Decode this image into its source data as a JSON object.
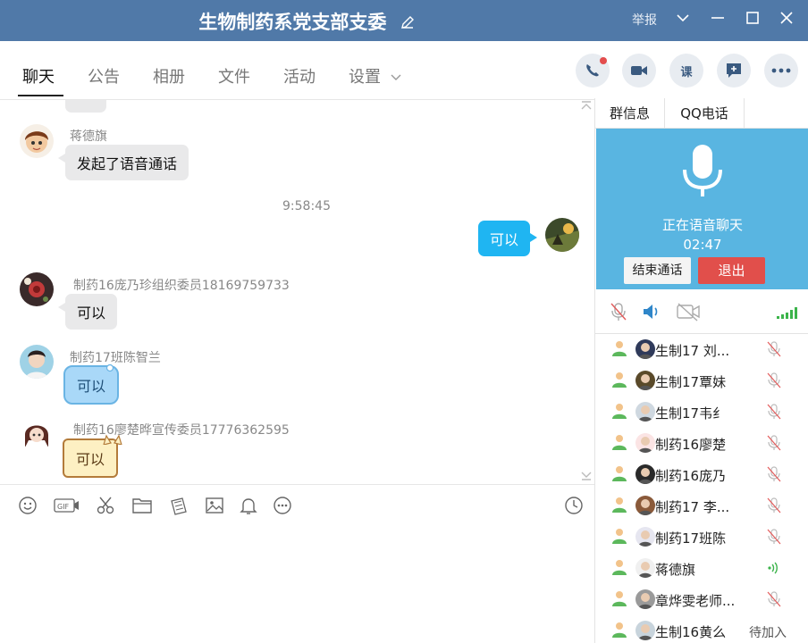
{
  "window": {
    "title": "生物制药系党支部支委",
    "report_label": "举报"
  },
  "tabs": [
    {
      "label": "聊天"
    },
    {
      "label": "公告"
    },
    {
      "label": "相册"
    },
    {
      "label": "文件"
    },
    {
      "label": "活动"
    },
    {
      "label": "设置"
    }
  ],
  "header_buttons": {
    "lesson_label": "课"
  },
  "messages": {
    "m1": {
      "sender": "蒋德旗",
      "text": "发起了语音通话"
    },
    "timestamp": "9:58:45",
    "m2": {
      "text": "可以"
    },
    "m3": {
      "sender": "制药16庞乃珍组织委员18169759733",
      "text": "可以"
    },
    "m4": {
      "sender": "制药17班陈智兰",
      "text": "可以"
    },
    "m5": {
      "sender": "制药16廖楚晔宣传委员17776362595",
      "text": "可以"
    }
  },
  "right_panel": {
    "tabs": [
      {
        "label": "群信息"
      },
      {
        "label": "QQ电话"
      }
    ],
    "call": {
      "status": "正在语音聊天",
      "duration": "02:47",
      "end_label": "结束通话",
      "quit_label": "退出"
    },
    "members": [
      {
        "name": "生制17 刘...",
        "status": "muted"
      },
      {
        "name": "生制17覃妹",
        "status": "muted"
      },
      {
        "name": "生制17韦纟",
        "status": "muted"
      },
      {
        "name": "制药16廖楚",
        "status": "muted"
      },
      {
        "name": "制药16庞乃",
        "status": "muted"
      },
      {
        "name": "制药17  李...",
        "status": "muted"
      },
      {
        "name": "制药17班陈",
        "status": "muted"
      },
      {
        "name": "蒋德旗",
        "status": "speaking"
      },
      {
        "name": "章烨雯老师...",
        "status": "muted"
      },
      {
        "name": "生制16黄么",
        "status": "待加入"
      }
    ]
  },
  "colors": {
    "titlebar": "#5079a8",
    "call_panel": "#59b5e1",
    "quit_button": "#e14f4b",
    "my_bubble": "#1fb5f2"
  }
}
